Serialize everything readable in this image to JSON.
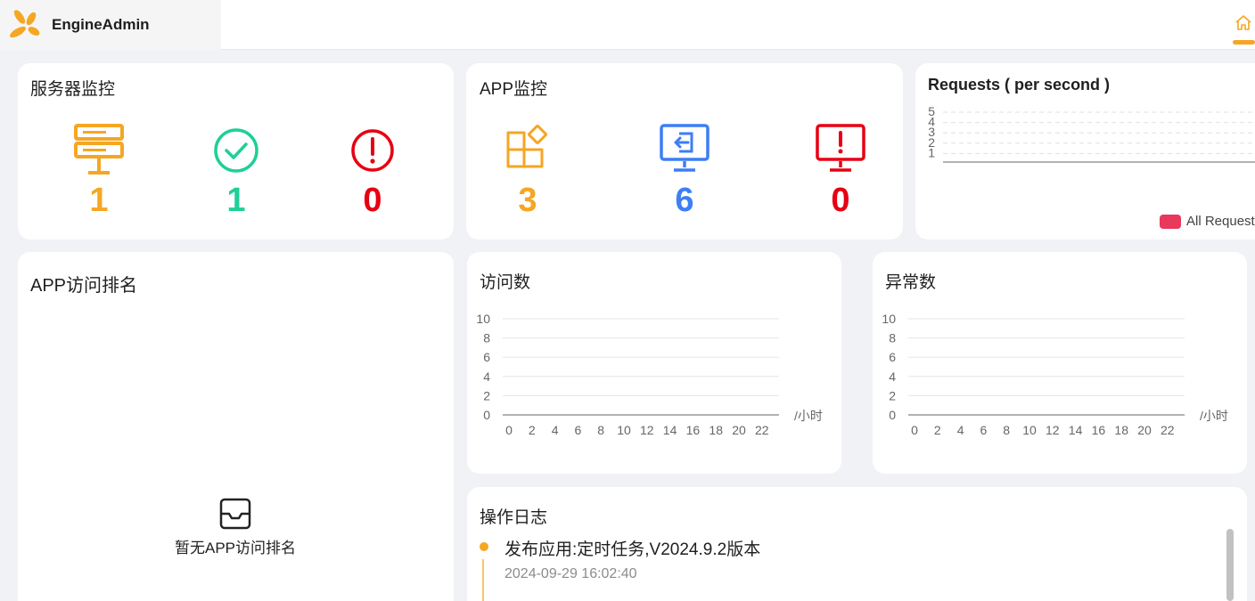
{
  "header": {
    "app_name": "EngineAdmin",
    "accent": "#f5a623"
  },
  "server_monitor": {
    "title": "服务器监控",
    "stats": [
      {
        "icon": "server-icon",
        "value": "1",
        "color": "#f5a623"
      },
      {
        "icon": "check-circle-icon",
        "value": "1",
        "color": "#1fcf98"
      },
      {
        "icon": "alert-circle-icon",
        "value": "0",
        "color": "#e60012"
      }
    ]
  },
  "app_monitor": {
    "title": "APP监控",
    "stats": [
      {
        "icon": "apps-icon",
        "value": "3",
        "color": "#f5a623"
      },
      {
        "icon": "monitor-login-icon",
        "value": "6",
        "color": "#3d7ef5"
      },
      {
        "icon": "monitor-alert-icon",
        "value": "0",
        "color": "#e60012"
      }
    ]
  },
  "requests": {
    "title": "Requests ( per second )",
    "legend": "All Request"
  },
  "app_ranking": {
    "title": "APP访问排名",
    "empty_text": "暂无APP访问排名"
  },
  "visits": {
    "title": "访问数",
    "unit": "/小时"
  },
  "errors": {
    "title": "异常数",
    "unit": "/小时"
  },
  "op_log": {
    "title": "操作日志",
    "items": [
      {
        "text": "发布应用:定时任务,V2024.9.2版本",
        "time": "2024-09-29 16:02:40"
      }
    ]
  },
  "chart_data": [
    {
      "type": "line",
      "title": "Requests ( per second )",
      "y_ticks": [
        1,
        2,
        3,
        4,
        5
      ],
      "ylim": [
        0,
        5
      ],
      "series": [
        {
          "name": "All Request",
          "values": []
        }
      ],
      "grid": true,
      "legend": "bottom-right"
    },
    {
      "type": "line",
      "title": "访问数",
      "x": [
        0,
        2,
        4,
        6,
        8,
        10,
        12,
        14,
        16,
        18,
        20,
        22
      ],
      "y_ticks": [
        0,
        2,
        4,
        6,
        8,
        10
      ],
      "ylim": [
        0,
        10
      ],
      "xlabel": "/小时",
      "series": [
        {
          "values": []
        }
      ],
      "grid": true
    },
    {
      "type": "line",
      "title": "异常数",
      "x": [
        0,
        2,
        4,
        6,
        8,
        10,
        12,
        14,
        16,
        18,
        20,
        22
      ],
      "y_ticks": [
        0,
        2,
        4,
        6,
        8,
        10
      ],
      "ylim": [
        0,
        10
      ],
      "xlabel": "/小时",
      "series": [
        {
          "values": []
        }
      ],
      "grid": true
    }
  ]
}
